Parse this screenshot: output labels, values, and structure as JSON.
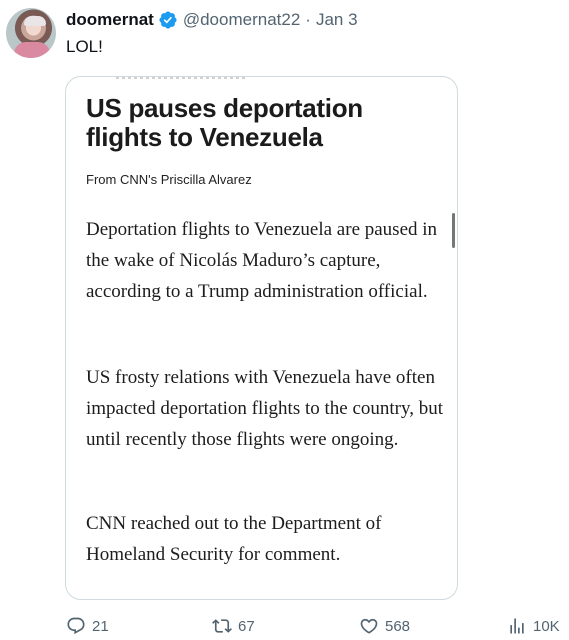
{
  "tweet": {
    "display_name": "doomernat",
    "handle": "@doomernat22",
    "separator": "·",
    "date": "Jan 3",
    "text": "LOL!"
  },
  "article": {
    "headline": "US pauses deportation flights to Venezuela",
    "byline": "From CNN's Priscilla Alvarez",
    "paragraphs": [
      "Deportation flights to Venezuela are paused in the wake of Nicolás Maduro’s capture, according to a Trump administration official.",
      "US frosty relations with Venezuela have often impacted deportation flights to the country, but until recently those flights were ongoing.",
      "CNN reached out to the Department of Homeland Security for comment."
    ]
  },
  "actions": {
    "replies": "21",
    "reposts": "67",
    "likes": "568",
    "views": "10K"
  },
  "colors": {
    "verified": "#1d9bf0",
    "secondary_text": "#536471",
    "border": "#cfd9de"
  }
}
